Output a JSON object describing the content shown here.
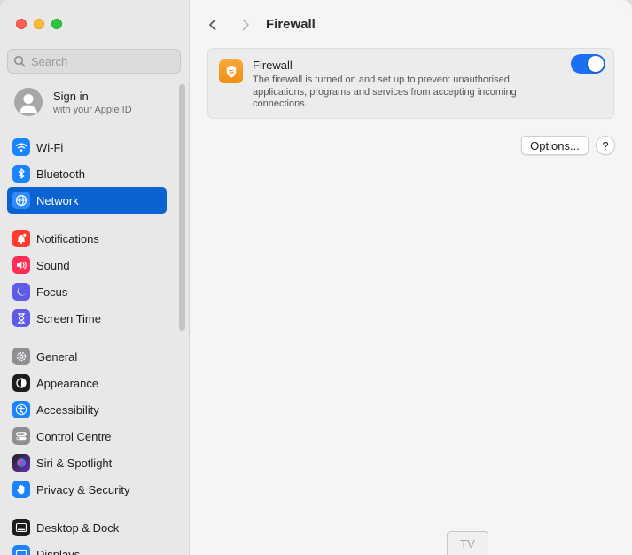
{
  "window": {
    "title": "Firewall"
  },
  "sidebar": {
    "search_placeholder": "Search",
    "account": {
      "title": "Sign in",
      "subtitle": "with your Apple ID"
    },
    "groups": [
      [
        {
          "label": "Wi-Fi",
          "icon": "wifi-icon",
          "color": "#1a84ff",
          "active": false
        },
        {
          "label": "Bluetooth",
          "icon": "bluetooth-icon",
          "color": "#1a84ff",
          "active": false
        },
        {
          "label": "Network",
          "icon": "globe-icon",
          "color": "#1a84ff",
          "active": true
        }
      ],
      [
        {
          "label": "Notifications",
          "icon": "bell-icon",
          "color": "#ff3b30",
          "active": false
        },
        {
          "label": "Sound",
          "icon": "speaker-icon",
          "color": "#ff2d55",
          "active": false
        },
        {
          "label": "Focus",
          "icon": "moon-icon",
          "color": "#5e5ce6",
          "active": false
        },
        {
          "label": "Screen Time",
          "icon": "hourglass-icon",
          "color": "#5e5ce6",
          "active": false
        }
      ],
      [
        {
          "label": "General",
          "icon": "gear-icon",
          "color": "#8e8e93",
          "active": false
        },
        {
          "label": "Appearance",
          "icon": "appearance-icon",
          "color": "#1d1d1f",
          "active": false
        },
        {
          "label": "Accessibility",
          "icon": "accessibility-icon",
          "color": "#1a84ff",
          "active": false
        },
        {
          "label": "Control Centre",
          "icon": "control-centre-icon",
          "color": "#8e8e93",
          "active": false
        },
        {
          "label": "Siri & Spotlight",
          "icon": "siri-icon",
          "color": "#b03cd6",
          "active": false
        },
        {
          "label": "Privacy & Security",
          "icon": "hand-icon",
          "color": "#1a84ff",
          "active": false
        }
      ],
      [
        {
          "label": "Desktop & Dock",
          "icon": "dock-icon",
          "color": "#1d1d1f",
          "active": false
        },
        {
          "label": "Displays",
          "icon": "display-icon",
          "color": "#1a84ff",
          "active": false
        }
      ]
    ]
  },
  "main": {
    "firewall_card": {
      "title": "Firewall",
      "description": "The firewall is turned on and set up to prevent unauthorised applications, programs and services from accepting incoming connections.",
      "enabled": true
    },
    "options_label": "Options...",
    "help_label": "?"
  },
  "tooltip": {
    "text": "TV"
  },
  "colors": {
    "accent": "#0a63d1",
    "toggle_on": "#1a6ff2",
    "firewall_icon": "#f59a20"
  }
}
